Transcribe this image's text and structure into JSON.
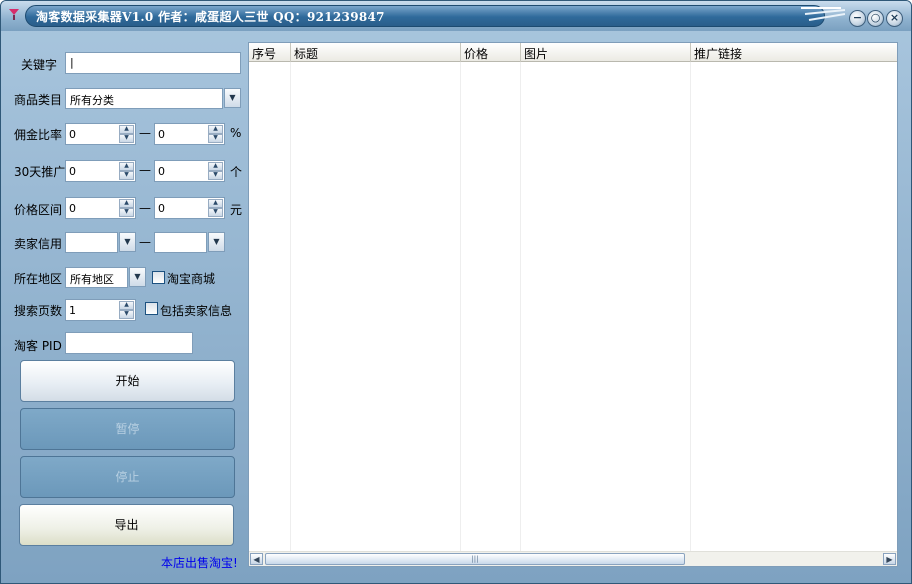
{
  "window": {
    "title": "淘客数据采集器V1.0    作者：咸蛋超人三世 QQ：921239847",
    "minimize_glyph": "−",
    "maximize_glyph": "○",
    "close_glyph": "×"
  },
  "form": {
    "keyword": {
      "label": "关键字",
      "value": "|"
    },
    "category": {
      "label": "商品类目",
      "value": "所有分类"
    },
    "commission": {
      "label": "佣金比率",
      "min": "0",
      "max": "0",
      "unit": "%"
    },
    "promo30": {
      "label": "30天推广",
      "min": "0",
      "max": "0",
      "unit": "个"
    },
    "price": {
      "label": "价格区间",
      "min": "0",
      "max": "0",
      "unit": "元"
    },
    "seller_credit": {
      "label": "卖家信用",
      "min": "",
      "max": ""
    },
    "region": {
      "label": "所在地区",
      "value": "所有地区",
      "tmall_label": "淘宝商城"
    },
    "pages": {
      "label": "搜索页数",
      "value": "1",
      "seller_info_label": "包括卖家信息"
    },
    "pid": {
      "label": "淘客 PID",
      "value": ""
    },
    "dash": "—"
  },
  "buttons": {
    "start": "开始",
    "pause": "暂停",
    "stop": "停止",
    "export": "导出"
  },
  "shop_link": "本店出售淘宝!",
  "table": {
    "columns": [
      "序号",
      "标题",
      "价格",
      "图片",
      "推广链接"
    ]
  },
  "icons": {
    "spin_up": "▲",
    "spin_down": "▼",
    "dropdown": "▼",
    "scroll_left": "◀",
    "scroll_right": "▶",
    "thumb_grip": "|||"
  }
}
